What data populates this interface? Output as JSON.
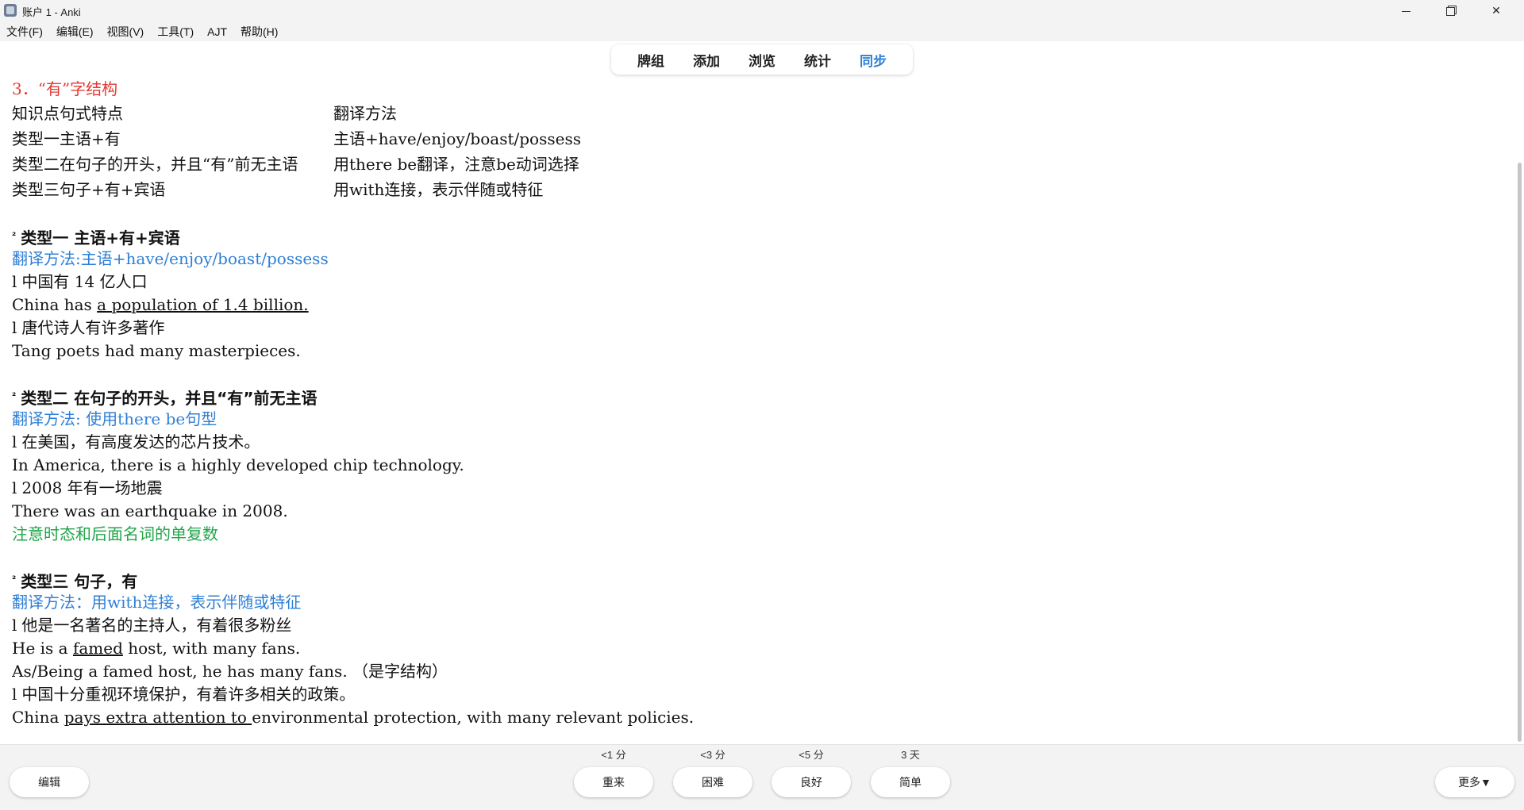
{
  "window": {
    "title": "账户 1 - Anki",
    "minimize": "—",
    "maximize": "□",
    "close": "✕"
  },
  "menu": [
    "文件(F)",
    "编辑(E)",
    "视图(V)",
    "工具(T)",
    "AJT",
    "帮助(H)"
  ],
  "tabs": [
    "牌组",
    "添加",
    "浏览",
    "统计",
    "同步"
  ],
  "active_tab": "同步",
  "card": {
    "heading": "3．“有”字结构",
    "table": {
      "header": [
        "知识点句式特点",
        "翻译方法"
      ],
      "rows": [
        [
          "类型一主语+有",
          "主语+have/enjoy/boast/possess"
        ],
        [
          "类型二在句子的开头，并且“有”前无主语",
          "用there be翻译，注意be动词选择"
        ],
        [
          "类型三句子+有+宾语",
          "用with连接，表示伴随或特征"
        ]
      ]
    },
    "sections": [
      {
        "marker": "²",
        "title": "类型一 主语+有+宾语",
        "method": "翻译方法:主语+have/enjoy/boast/possess"
      },
      {
        "marker": "²",
        "title": "类型二 在句子的开头，并且“有”前无主语",
        "method": "翻译方法: 使用there be句型"
      },
      {
        "marker": "²",
        "title": "类型三 句子，有",
        "method": "翻译方法：用with连接，表示伴随或特征"
      }
    ],
    "s1": {
      "ex1_cn": "中国有 14 亿人口",
      "ex1_en_a": "China has ",
      "ex1_en_u": "a population of 1.4 billion.",
      "ex2_cn": "唐代诗人有许多著作",
      "ex2_en": "Tang poets had many masterpieces."
    },
    "s2": {
      "ex1_cn": "在美国，有高度发达的芯片技术。",
      "ex1_en": "In America, there is a highly developed chip technology.",
      "ex2_cn": "2008 年有一场地震",
      "ex2_en": "There was an earthquake in 2008.",
      "note": "注意时态和后面名词的单复数"
    },
    "s3": {
      "ex1_cn": "他是一名著名的主持人，有着很多粉丝",
      "ex1_en_a": "He is a ",
      "ex1_en_u": "famed",
      "ex1_en_b": " host, with many fans.",
      "ex1_alt": "As/Being a famed host, he has many fans. （是字结构）",
      "ex2_cn": "中国十分重视环境保护，有着许多相关的政策。",
      "ex2_en_a": "China ",
      "ex2_en_u": "pays extra attention to ",
      "ex2_en_b": "environmental protection, with many relevant policies."
    },
    "bullet": "l"
  },
  "bottom": {
    "edit": "编辑",
    "more": "更多▼",
    "answers": [
      {
        "label": "重来",
        "time": "<1 分"
      },
      {
        "label": "困难",
        "time": "<3 分"
      },
      {
        "label": "良好",
        "time": "<5 分"
      },
      {
        "label": "简单",
        "time": "3 天"
      }
    ]
  }
}
